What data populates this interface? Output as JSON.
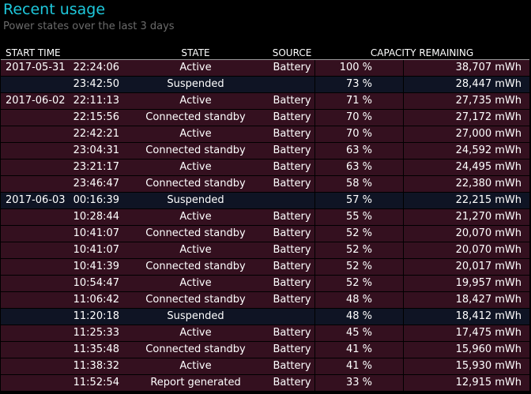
{
  "header": {
    "title": "Recent usage",
    "subtitle": "Power states over the last 3 days"
  },
  "columns": {
    "start_time": "START TIME",
    "state": "STATE",
    "source": "SOURCE",
    "capacity": "CAPACITY REMAINING"
  },
  "colors": {
    "title": "#1ec8dc",
    "row_active": "#34101f",
    "row_suspended": "#0f1424"
  },
  "rows": [
    {
      "date": "2017-05-31",
      "time": "22:24:06",
      "state": "Active",
      "source": "Battery",
      "percent": "100 %",
      "mwh": "38,707 mWh"
    },
    {
      "date": "",
      "time": "23:42:50",
      "state": "Suspended",
      "source": "",
      "percent": "73 %",
      "mwh": "28,447 mWh"
    },
    {
      "date": "2017-06-02",
      "time": "22:11:13",
      "state": "Active",
      "source": "Battery",
      "percent": "71 %",
      "mwh": "27,735 mWh"
    },
    {
      "date": "",
      "time": "22:15:56",
      "state": "Connected standby",
      "source": "Battery",
      "percent": "70 %",
      "mwh": "27,172 mWh"
    },
    {
      "date": "",
      "time": "22:42:21",
      "state": "Active",
      "source": "Battery",
      "percent": "70 %",
      "mwh": "27,000 mWh"
    },
    {
      "date": "",
      "time": "23:04:31",
      "state": "Connected standby",
      "source": "Battery",
      "percent": "63 %",
      "mwh": "24,592 mWh"
    },
    {
      "date": "",
      "time": "23:21:17",
      "state": "Active",
      "source": "Battery",
      "percent": "63 %",
      "mwh": "24,495 mWh"
    },
    {
      "date": "",
      "time": "23:46:47",
      "state": "Connected standby",
      "source": "Battery",
      "percent": "58 %",
      "mwh": "22,380 mWh"
    },
    {
      "date": "2017-06-03",
      "time": "00:16:39",
      "state": "Suspended",
      "source": "",
      "percent": "57 %",
      "mwh": "22,215 mWh"
    },
    {
      "date": "",
      "time": "10:28:44",
      "state": "Active",
      "source": "Battery",
      "percent": "55 %",
      "mwh": "21,270 mWh"
    },
    {
      "date": "",
      "time": "10:41:07",
      "state": "Connected standby",
      "source": "Battery",
      "percent": "52 %",
      "mwh": "20,070 mWh"
    },
    {
      "date": "",
      "time": "10:41:07",
      "state": "Active",
      "source": "Battery",
      "percent": "52 %",
      "mwh": "20,070 mWh"
    },
    {
      "date": "",
      "time": "10:41:39",
      "state": "Connected standby",
      "source": "Battery",
      "percent": "52 %",
      "mwh": "20,017 mWh"
    },
    {
      "date": "",
      "time": "10:54:47",
      "state": "Active",
      "source": "Battery",
      "percent": "52 %",
      "mwh": "19,957 mWh"
    },
    {
      "date": "",
      "time": "11:06:42",
      "state": "Connected standby",
      "source": "Battery",
      "percent": "48 %",
      "mwh": "18,427 mWh"
    },
    {
      "date": "",
      "time": "11:20:18",
      "state": "Suspended",
      "source": "",
      "percent": "48 %",
      "mwh": "18,412 mWh"
    },
    {
      "date": "",
      "time": "11:25:33",
      "state": "Active",
      "source": "Battery",
      "percent": "45 %",
      "mwh": "17,475 mWh"
    },
    {
      "date": "",
      "time": "11:35:48",
      "state": "Connected standby",
      "source": "Battery",
      "percent": "41 %",
      "mwh": "15,960 mWh"
    },
    {
      "date": "",
      "time": "11:38:32",
      "state": "Active",
      "source": "Battery",
      "percent": "41 %",
      "mwh": "15,930 mWh"
    },
    {
      "date": "",
      "time": "11:52:54",
      "state": "Report generated",
      "source": "Battery",
      "percent": "33 %",
      "mwh": "12,915 mWh"
    }
  ]
}
